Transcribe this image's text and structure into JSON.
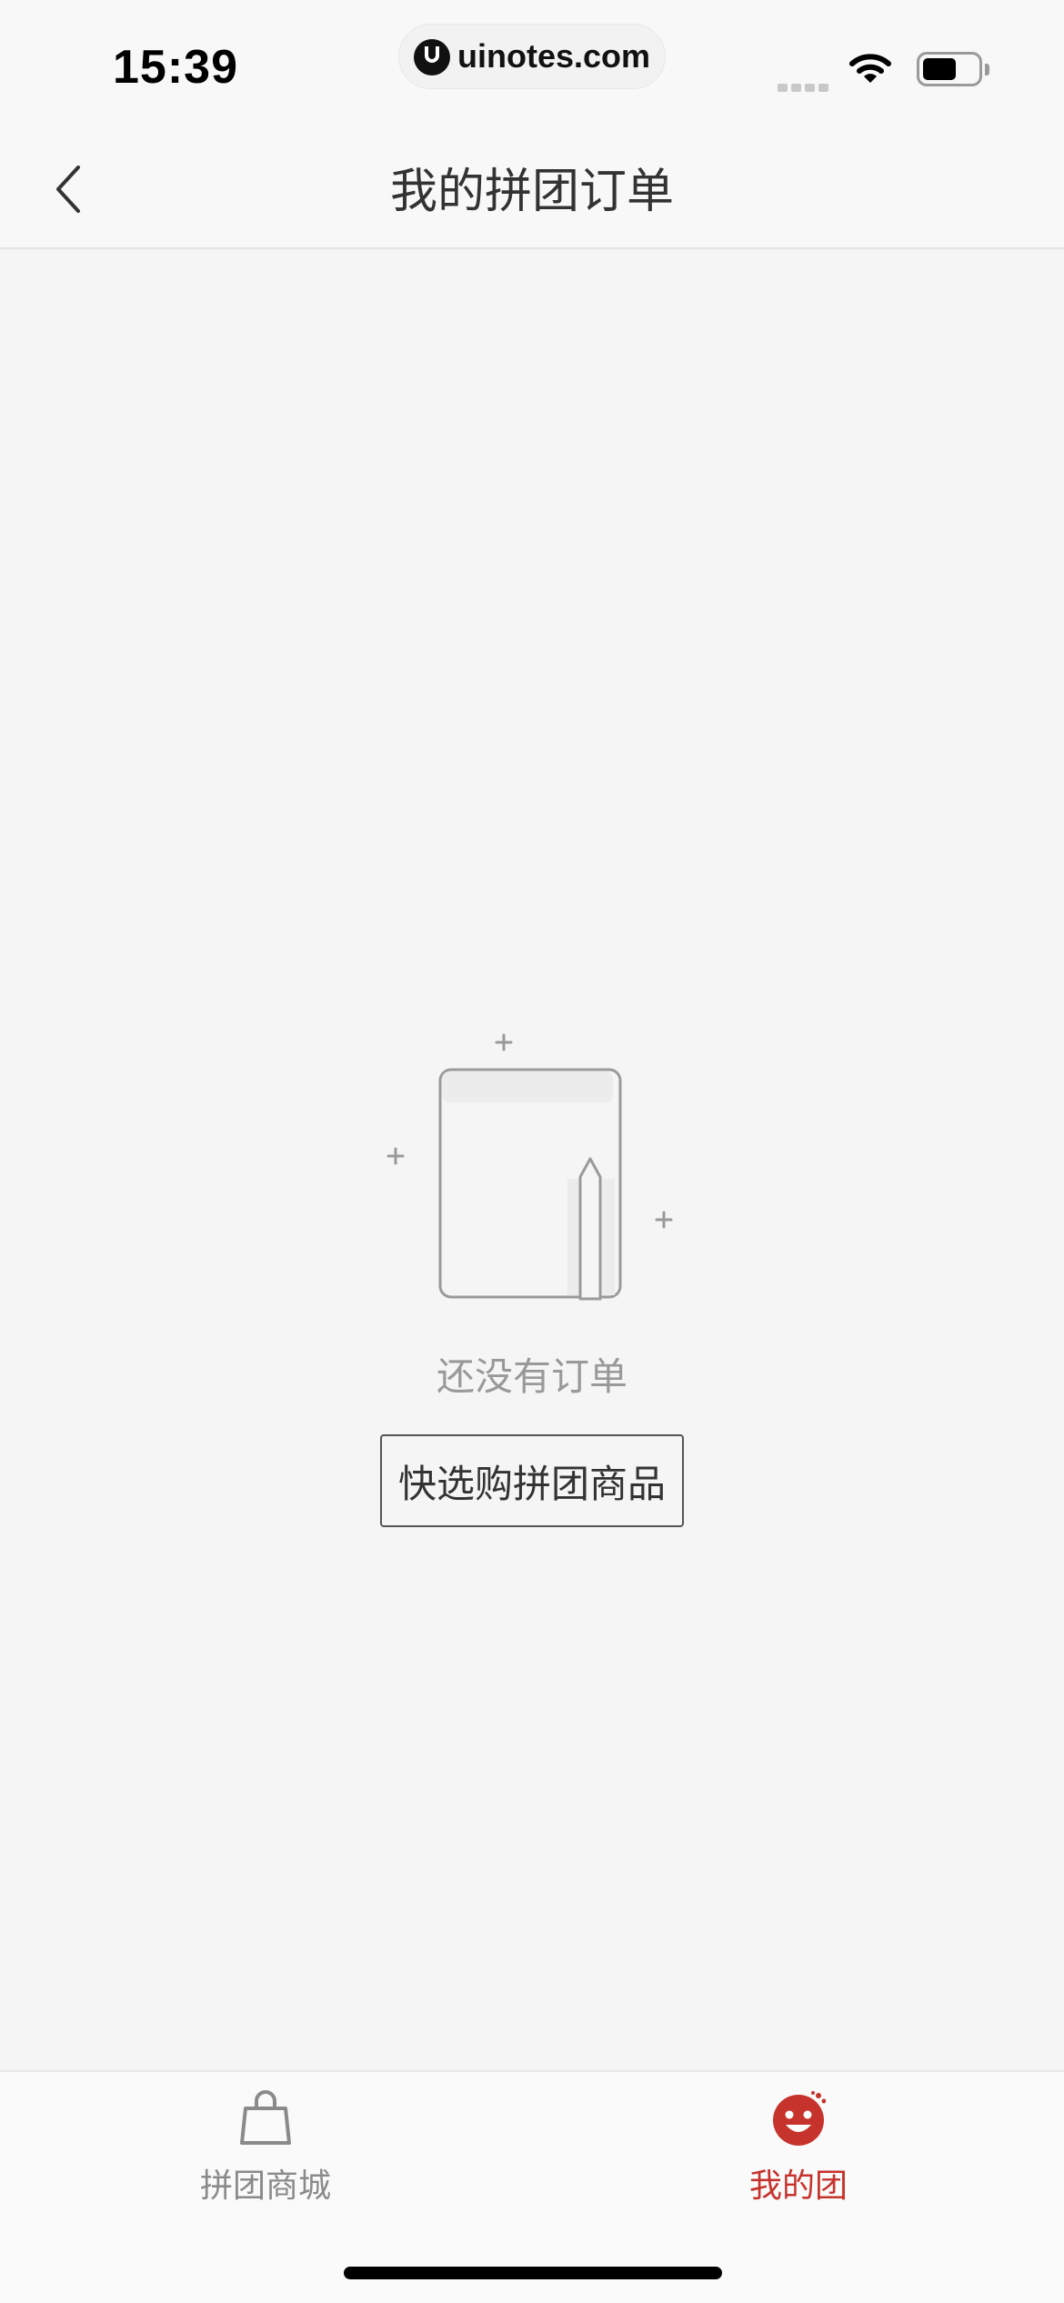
{
  "status_bar": {
    "time": "15:39",
    "url": "uinotes.com"
  },
  "nav": {
    "title": "我的拼团订单",
    "back_icon": "chevron-left-icon"
  },
  "empty_state": {
    "illustration_icon": "notebook-pencil-icon",
    "message": "还没有订单",
    "button_label": "快选购拼团商品"
  },
  "tab_bar": {
    "items": [
      {
        "label": "拼团商城",
        "icon": "shopping-bag-icon",
        "active": false
      },
      {
        "label": "我的团",
        "icon": "smiley-face-icon",
        "active": true
      }
    ],
    "active_color": "#c6332c",
    "inactive_color": "#8a8a8a"
  }
}
